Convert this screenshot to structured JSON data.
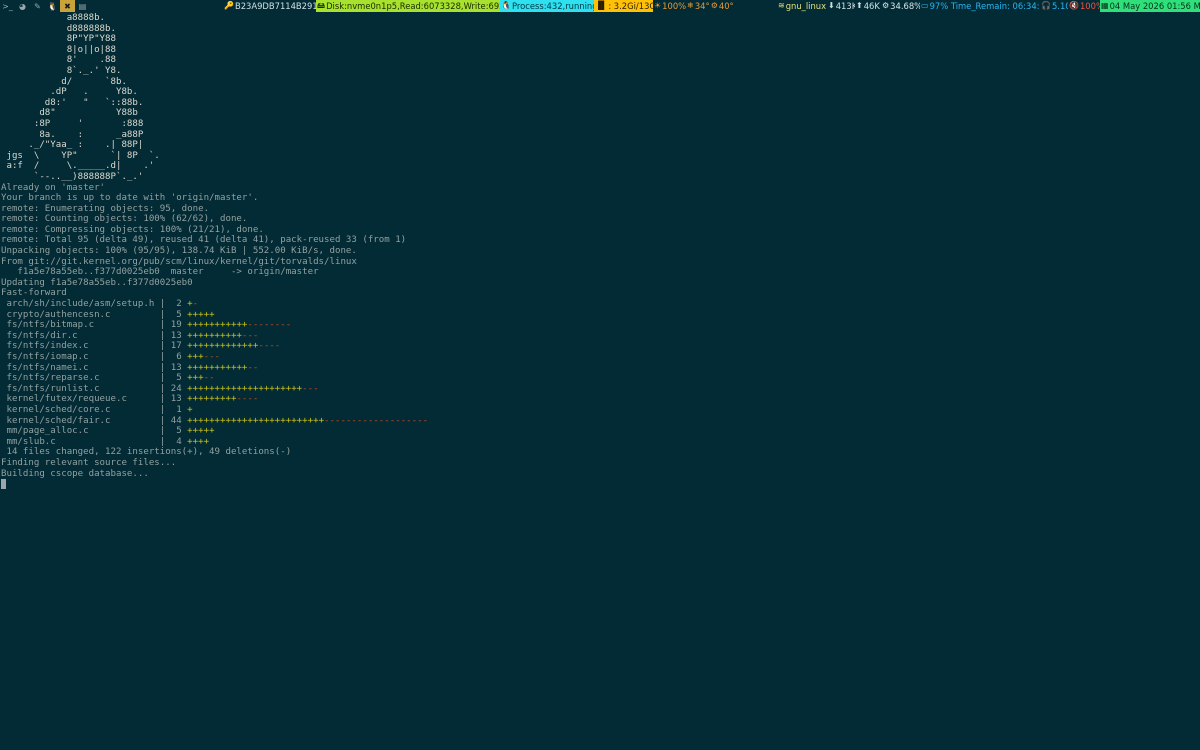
{
  "taskbar": {
    "workspaces": [
      {
        "icon": "terminal-icon",
        "glyph": ">_"
      },
      {
        "icon": "firefox-icon",
        "glyph": "◕"
      },
      {
        "icon": "edit-icon",
        "glyph": "✎"
      },
      {
        "icon": "tux-icon",
        "glyph": "🐧"
      },
      {
        "icon": "tools-icon",
        "glyph": "✖"
      },
      {
        "icon": "document-icon",
        "glyph": "▤"
      }
    ],
    "active_workspace": 4,
    "host": "B23A9DB7114B2915",
    "disk": "Disk:nvme0n1p5,Read:6073328,Write:6921520",
    "process": "Process:432,running:1",
    "memory": ": 3.2Gi/13Gi",
    "brightness": "100%",
    "temp1": "34°",
    "temp2": "40°",
    "wifi": "gnu_linux",
    "download": "413K",
    "upload": "46K",
    "cpu": "34.68%",
    "battery": "97% Time_Remain: 06:34:20",
    "volume": "5.10",
    "mute": "100%",
    "date": "04 May 2026 01:56 Mon",
    "colors": {
      "disk": "#a6e22e",
      "process": "#2ee0f0",
      "memory": "#ffc107",
      "date": "#2fe07a",
      "active_workspace": "#caa23a"
    }
  },
  "terminal": {
    "ascii_art": [
      "            a8888b.",
      "            d888888b.",
      "            8P\"YP\"Y88",
      "            8|o||o|88",
      "            8'    .88",
      "            8`._.' Y8.",
      "           d/      `8b.",
      "         .dP   .     Y8b.",
      "        d8:'   \"   `::88b.",
      "       d8\"           Y88b",
      "      :8P     '       :888",
      "       8a.    :      _a88P",
      "     ._/\"Yaa_ :    .| 88P|",
      " jgs  \\    YP\"      `| 8P  `.",
      " a:f  /     \\._____.d|    .'",
      "      `--..__)888888P`._.'"
    ],
    "output_lines": [
      "Already on 'master'",
      "Your branch is up to date with 'origin/master'.",
      "remote: Enumerating objects: 95, done.",
      "remote: Counting objects: 100% (62/62), done.",
      "remote: Compressing objects: 100% (21/21), done.",
      "remote: Total 95 (delta 49), reused 41 (delta 41), pack-reused 33 (from 1)",
      "Unpacking objects: 100% (95/95), 138.74 KiB | 552.00 KiB/s, done.",
      "From git://git.kernel.org/pub/scm/linux/kernel/git/torvalds/linux",
      "   f1a5e78a55eb..f377d0025eb0  master     -> origin/master",
      "Updating f1a5e78a55eb..f377d0025eb0",
      "Fast-forward"
    ],
    "diffstat": [
      {
        "file": "arch/sh/include/asm/setup.h",
        "changes": 2,
        "plus": 1,
        "minus": 1
      },
      {
        "file": "crypto/authencesn.c",
        "changes": 5,
        "plus": 5,
        "minus": 0
      },
      {
        "file": "fs/ntfs/bitmap.c",
        "changes": 19,
        "plus": 11,
        "minus": 8
      },
      {
        "file": "fs/ntfs/dir.c",
        "changes": 13,
        "plus": 10,
        "minus": 3
      },
      {
        "file": "fs/ntfs/index.c",
        "changes": 17,
        "plus": 13,
        "minus": 4
      },
      {
        "file": "fs/ntfs/iomap.c",
        "changes": 6,
        "plus": 3,
        "minus": 3
      },
      {
        "file": "fs/ntfs/namei.c",
        "changes": 13,
        "plus": 11,
        "minus": 2
      },
      {
        "file": "fs/ntfs/reparse.c",
        "changes": 5,
        "plus": 3,
        "minus": 2
      },
      {
        "file": "fs/ntfs/runlist.c",
        "changes": 24,
        "plus": 21,
        "minus": 3
      },
      {
        "file": "kernel/futex/requeue.c",
        "changes": 13,
        "plus": 9,
        "minus": 4
      },
      {
        "file": "kernel/sched/core.c",
        "changes": 1,
        "plus": 1,
        "minus": 0
      },
      {
        "file": "kernel/sched/fair.c",
        "changes": 44,
        "plus": 25,
        "minus": 19
      },
      {
        "file": "mm/page_alloc.c",
        "changes": 5,
        "plus": 5,
        "minus": 0
      },
      {
        "file": "mm/slub.c",
        "changes": 4,
        "plus": 4,
        "minus": 0
      }
    ],
    "summary_lines": [
      " 14 files changed, 122 insertions(+), 49 deletions(-)",
      "Finding relevant source files...",
      "Building cscope database..."
    ]
  }
}
